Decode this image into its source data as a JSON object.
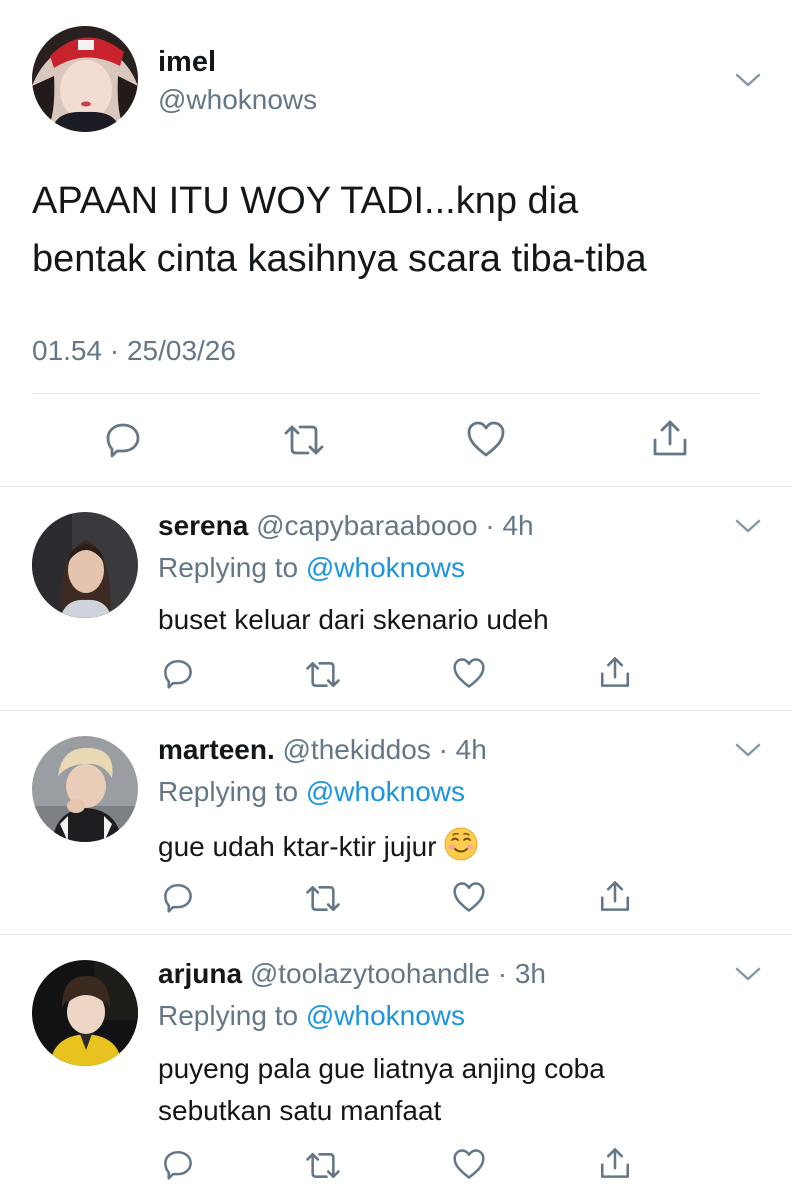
{
  "main_tweet": {
    "display_name": "imel",
    "handle": "@whoknows",
    "text_line1": "APAAN ITU WOY TADI...knp dia",
    "text_line2": "bentak cinta kasihnya scara tiba-tiba",
    "timestamp": "01.54 · 25/03/26"
  },
  "replies": [
    {
      "display_name": "serena",
      "handle": "@capybaraabooo",
      "time": "· 4h",
      "replying_prefix": "Replying to",
      "replying_handle": "@whoknows",
      "text_line1": "buset keluar dari skenario udeh",
      "text_line2": ""
    },
    {
      "display_name": "marteen.",
      "handle": "@thekiddos",
      "time": "· 4h",
      "replying_prefix": "Replying to",
      "replying_handle": "@whoknows",
      "text_line1": "gue udah ktar-ktir jujur",
      "text_line2": ""
    },
    {
      "display_name": "arjuna",
      "handle": "@toolazytoohandle",
      "time": "· 3h",
      "replying_prefix": "Replying to",
      "replying_handle": "@whoknows",
      "text_line1": "puyeng pala gue liatnya anjing coba",
      "text_line2": "sebutkan satu manfaat"
    }
  ],
  "colors": {
    "text": "#14171a",
    "secondary": "#657786",
    "link": "#1b95e0",
    "divider": "#e1e8ed"
  },
  "icons": [
    "chevron-down-icon",
    "reply-icon",
    "retweet-icon",
    "like-icon",
    "share-icon",
    "smiling-face-emoji"
  ]
}
